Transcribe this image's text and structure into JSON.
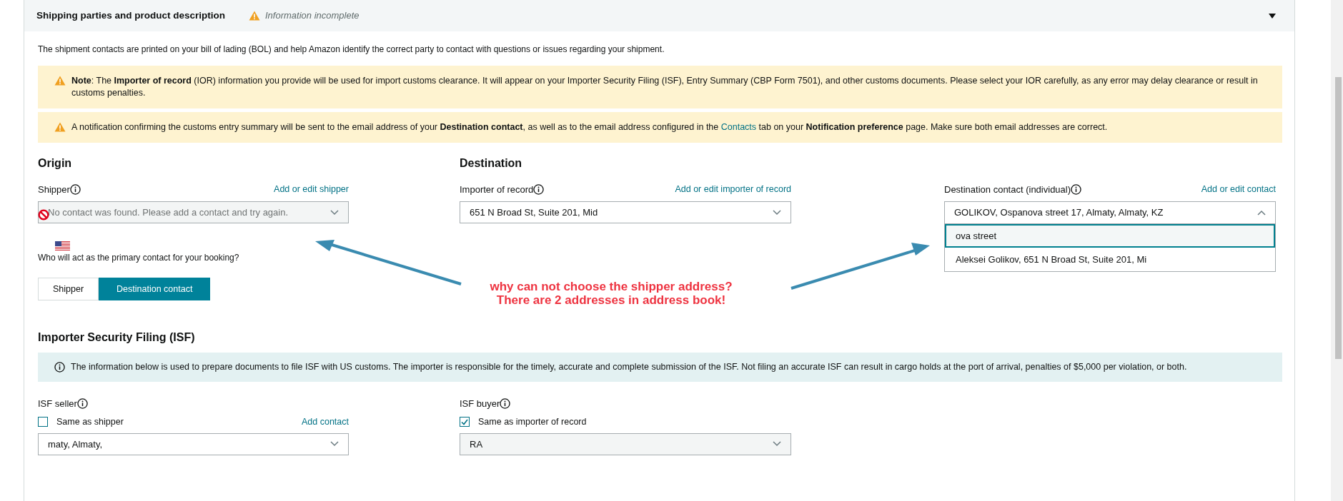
{
  "section": {
    "title": "Shipping parties and product description",
    "status": "Information incomplete",
    "expanded": true
  },
  "intro": "The shipment contacts are printed on your bill of lading (BOL) and help Amazon identify the correct party to contact with questions or issues regarding your shipment.",
  "alerts": [
    {
      "kind": "warning",
      "parts": [
        {
          "kind": "text",
          "text": "**Note**: The **Importer of record** (IOR) information you provide will be used for import customs clearance. It will appear on your Importer Security Filing (ISF), Entry Summary (CBP Form 7501), and other customs documents. Please select your IOR carefully, as any error may delay clearance or result in customs penalties."
        }
      ]
    },
    {
      "kind": "warning",
      "parts": [
        {
          "kind": "text",
          "text": "A notification confirming the customs entry summary will be sent to the email address of your **Destination contact**, as well as to the email address configured in the "
        },
        {
          "kind": "link",
          "text": "Contacts"
        },
        {
          "kind": "text",
          "text": " tab on your **Notification preference** page. Make sure both email addresses are correct."
        }
      ]
    }
  ],
  "origin": {
    "heading": "Origin",
    "shipper": {
      "label": "Shipper",
      "link": "Add or edit shipper",
      "placeholder": "No contact was found. Please add a contact and try again.",
      "disabled": true,
      "expanded": false
    },
    "primary_contact": {
      "question": "Who will act as the primary contact for your booking?",
      "options": [
        {
          "label": "Shipper",
          "selected": false
        },
        {
          "label": "Destination contact",
          "selected": true
        }
      ]
    }
  },
  "destination": {
    "heading": "Destination",
    "importer": {
      "label": "Importer of record",
      "link": "Add or edit importer of record",
      "value": "651 N Broad St, Suite 201, Mid",
      "disabled": false,
      "expanded": false
    },
    "contact": {
      "label": "Destination contact (individual)",
      "link": "Add or edit contact",
      "value": "GOLIKOV, Ospanova street 17, Almaty, Almaty, KZ",
      "disabled": false,
      "expanded": true,
      "options": [
        {
          "label": "ova street",
          "selected": true
        },
        {
          "label": "Aleksei Golikov, 651 N Broad St, Suite 201, Mi",
          "selected": false
        }
      ]
    }
  },
  "isf": {
    "heading": "Importer Security Filing (ISF)",
    "info": "The information below is used to prepare documents to file ISF with US customs. The importer is responsible for the timely, accurate and complete submission of the ISF. Not filing an accurate ISF can result in cargo holds at the port of arrival, penalties of $5,000 per violation, or both.",
    "seller": {
      "label": "ISF seller",
      "checkbox": {
        "label": "Same as shipper",
        "checked": false
      },
      "link": "Add contact",
      "value": "maty, Almaty,",
      "disabled": false,
      "expanded": false
    },
    "buyer": {
      "label": "ISF buyer",
      "checkbox": {
        "label": "Same as importer of record",
        "checked": true
      },
      "value": "RA",
      "disabled": true,
      "expanded": false
    }
  },
  "annotation": {
    "lines": [
      "why can not choose the shipper address?",
      "There are 2 addresses in address book!"
    ]
  }
}
